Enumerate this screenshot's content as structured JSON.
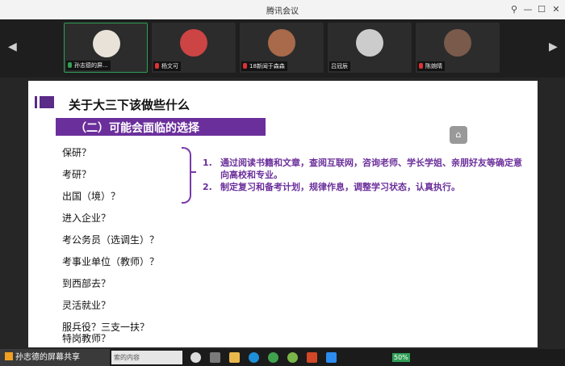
{
  "window": {
    "title": "腾讯会议"
  },
  "participants": [
    {
      "name": "孙志德的屏...",
      "avatar_color": "#e8e2d8"
    },
    {
      "name": "杨文可",
      "avatar_color": "#c44"
    },
    {
      "name": "18新闻于森森",
      "avatar_color": "#a86a4a"
    },
    {
      "name": "吕冠辰",
      "avatar_color": "#ccc"
    },
    {
      "name": "陈婉晴",
      "avatar_color": "#7a5a4a"
    }
  ],
  "slide": {
    "title": "关于大三下该做些什么",
    "subtitle": "（二）可能会面临的选择",
    "options": [
      "保研？",
      "考研？",
      "出国（境）？",
      "进入企业？",
      "考公务员（选调生）？",
      "考事业单位（教师）？",
      "到西部去？",
      "灵活就业？",
      "服兵役？三支一扶？",
      "特岗教师？"
    ],
    "notes": [
      {
        "num": "1.",
        "text": "通过阅读书籍和文章，查阅互联网，咨询老师、学长学姐、亲朋好友等确定意向高校和专业。"
      },
      {
        "num": "2.",
        "text": "制定复习和备考计划，规律作息，调整学习状态，认真执行。"
      }
    ]
  },
  "taskbar": {
    "share_label": "孙志德的屏幕共享",
    "search_text": "索的内容",
    "battery": "50%"
  },
  "colors": {
    "accent": "#6b2f9b",
    "active_border": "#2f9f55"
  }
}
